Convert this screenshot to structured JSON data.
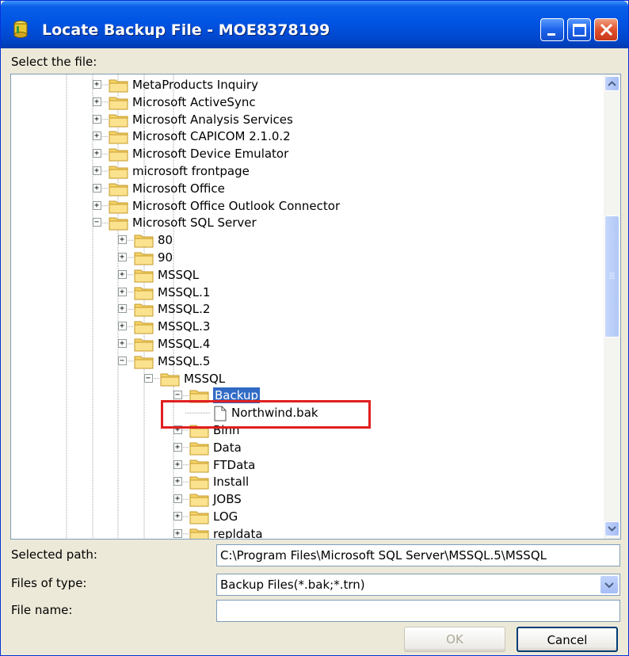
{
  "window": {
    "title": "Locate Backup File - MOE8378199",
    "title_color": "#0054e3"
  },
  "labels": {
    "select_file": "Select the file:",
    "selected_path": "Selected path:",
    "files_of_type": "Files of type:",
    "file_name": "File name:"
  },
  "tree": {
    "items": [
      {
        "label": "MetaProducts Inquiry",
        "level": 0,
        "expander": "+",
        "kind": "folder"
      },
      {
        "label": "Microsoft ActiveSync",
        "level": 0,
        "expander": "+",
        "kind": "folder"
      },
      {
        "label": "Microsoft Analysis Services",
        "level": 0,
        "expander": "+",
        "kind": "folder"
      },
      {
        "label": "Microsoft CAPICOM 2.1.0.2",
        "level": 0,
        "expander": "+",
        "kind": "folder"
      },
      {
        "label": "Microsoft Device Emulator",
        "level": 0,
        "expander": "+",
        "kind": "folder"
      },
      {
        "label": "microsoft frontpage",
        "level": 0,
        "expander": "+",
        "kind": "folder"
      },
      {
        "label": "Microsoft Office",
        "level": 0,
        "expander": "+",
        "kind": "folder"
      },
      {
        "label": "Microsoft Office Outlook Connector",
        "level": 0,
        "expander": "+",
        "kind": "folder"
      },
      {
        "label": "Microsoft SQL Server",
        "level": 0,
        "expander": "-",
        "kind": "folder"
      },
      {
        "label": "80",
        "level": 1,
        "expander": "+",
        "kind": "folder"
      },
      {
        "label": "90",
        "level": 1,
        "expander": "+",
        "kind": "folder"
      },
      {
        "label": "MSSQL",
        "level": 1,
        "expander": "+",
        "kind": "folder"
      },
      {
        "label": "MSSQL.1",
        "level": 1,
        "expander": "+",
        "kind": "folder"
      },
      {
        "label": "MSSQL.2",
        "level": 1,
        "expander": "+",
        "kind": "folder"
      },
      {
        "label": "MSSQL.3",
        "level": 1,
        "expander": "+",
        "kind": "folder"
      },
      {
        "label": "MSSQL.4",
        "level": 1,
        "expander": "+",
        "kind": "folder"
      },
      {
        "label": "MSSQL.5",
        "level": 1,
        "expander": "-",
        "kind": "folder"
      },
      {
        "label": "MSSQL",
        "level": 2,
        "expander": "-",
        "kind": "folder"
      },
      {
        "label": "Backup",
        "level": 3,
        "expander": "-",
        "kind": "folder",
        "selected": true
      },
      {
        "label": "Northwind.bak",
        "level": 4,
        "expander": "",
        "kind": "file"
      },
      {
        "label": "Binn",
        "level": 3,
        "expander": "+",
        "kind": "folder"
      },
      {
        "label": "Data",
        "level": 3,
        "expander": "+",
        "kind": "folder"
      },
      {
        "label": "FTData",
        "level": 3,
        "expander": "+",
        "kind": "folder"
      },
      {
        "label": "Install",
        "level": 3,
        "expander": "+",
        "kind": "folder"
      },
      {
        "label": "JOBS",
        "level": 3,
        "expander": "+",
        "kind": "folder"
      },
      {
        "label": "LOG",
        "level": 3,
        "expander": "+",
        "kind": "folder"
      },
      {
        "label": "repldata",
        "level": 3,
        "expander": "+",
        "kind": "folder"
      }
    ],
    "highlight_color": "#e02020",
    "selection_color": "#316ac5"
  },
  "fields": {
    "selected_path_value": "C:\\Program Files\\Microsoft SQL Server\\MSSQL.5\\MSSQL",
    "files_of_type_value": "Backup Files(*.bak;*.trn)",
    "file_name_value": ""
  },
  "buttons": {
    "ok": "OK",
    "cancel": "Cancel"
  }
}
